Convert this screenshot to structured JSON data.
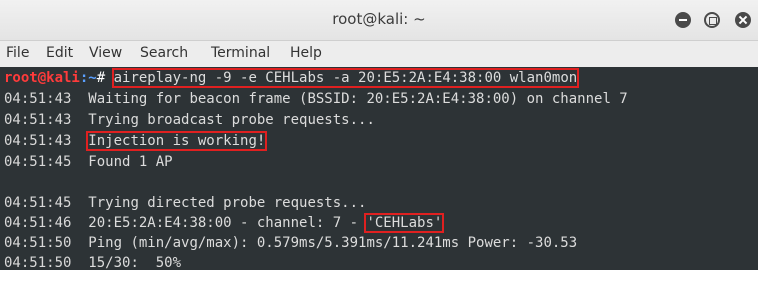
{
  "window": {
    "title": "root@kali: ~"
  },
  "menu": [
    "File",
    "Edit",
    "View",
    "Search",
    "Terminal",
    "Help"
  ],
  "terminal": {
    "prompt_user": "root@kali",
    "prompt_path": ":~",
    "prompt_symbol": "#",
    "command": "aireplay-ng -9 -e CEHLabs -a 20:E5:2A:E4:38:00 wlan0mon",
    "lines": [
      {
        "time": "04:51:43",
        "text": "Waiting for beacon frame (BSSID: 20:E5:2A:E4:38:00) on channel 7"
      },
      {
        "time": "04:51:43",
        "text": "Trying broadcast probe requests..."
      },
      {
        "time": "04:51:43",
        "text": "Injection is working!"
      },
      {
        "time": "04:51:45",
        "text": "Found 1 AP"
      },
      {
        "time": "04:51:45",
        "text": "Trying directed probe requests..."
      },
      {
        "time": "04:51:46",
        "text_pre": "20:E5:2A:E4:38:00 - channel: 7 - ",
        "text_hl": "'CEHLabs'"
      },
      {
        "time": "04:51:50",
        "text": "Ping (min/avg/max): 0.579ms/5.391ms/11.241ms Power: -30.53"
      },
      {
        "time": "04:51:50",
        "text": "15/30:  50%"
      }
    ]
  },
  "colors": {
    "highlight_box": "#e02020",
    "terminal_bg": "#2d3336",
    "prompt_user": "#ff3b3b",
    "prompt_path": "#5aa0ff"
  }
}
